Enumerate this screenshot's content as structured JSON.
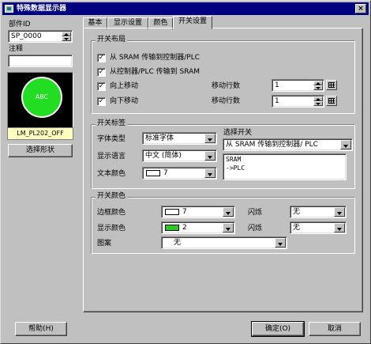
{
  "window": {
    "title": "特殊数据显示器",
    "close_label": "×"
  },
  "left": {
    "part_id_label": "部件ID",
    "part_id_value": "SP_0000",
    "comment_label": "注释",
    "comment_value": "",
    "preview_text": "ABC",
    "preview_name": "LM_PL202_OFF",
    "select_shape_label": "选择形状"
  },
  "tabs": [
    {
      "label": "基本"
    },
    {
      "label": "显示设置"
    },
    {
      "label": "颜色"
    },
    {
      "label": "开关设置"
    }
  ],
  "switch_layout": {
    "title": "开关布局",
    "opt_sram_to_plc": "从 SRAM 传输到控制器/PLC",
    "opt_plc_to_sram": "从控制器/PLC 传输到 SRAM",
    "opt_move_up": "向上移动",
    "opt_move_down": "向下移动",
    "move_rows_label": "移动行数",
    "move_up_rows": "1",
    "move_down_rows": "1",
    "check_mark": "✓"
  },
  "switch_label": {
    "title": "开关标签",
    "font_type_label": "字体类型",
    "font_type_value": "标准字体",
    "display_lang_label": "显示语言",
    "display_lang_value": "中文 (简体)",
    "text_color_label": "文本颜色",
    "text_color_value": "7",
    "select_switch_label": "选择开关",
    "select_switch_value": "从 SRAM 传输到控制器/ PLC",
    "label_text_line1": "SRAM",
    "label_text_line2": "->PLC"
  },
  "switch_color": {
    "title": "开关颜色",
    "border_color_label": "边框颜色",
    "border_color_value": "7",
    "display_color_label": "显示颜色",
    "display_color_value": "2",
    "blink_label": "闪烁",
    "blink1_value": "无",
    "blink2_value": "无",
    "pattern_label": "图案",
    "pattern_value": "无"
  },
  "footer": {
    "help_label": "帮助(H)",
    "ok_label": "确定(O)",
    "cancel_label": "取消"
  },
  "colors": {
    "title_bar": "#000080",
    "preview_circle": "#22dd22",
    "preview_name_bg": "#ffffc0",
    "swatch_white": "#ffffff",
    "swatch_green": "#22cc22"
  }
}
